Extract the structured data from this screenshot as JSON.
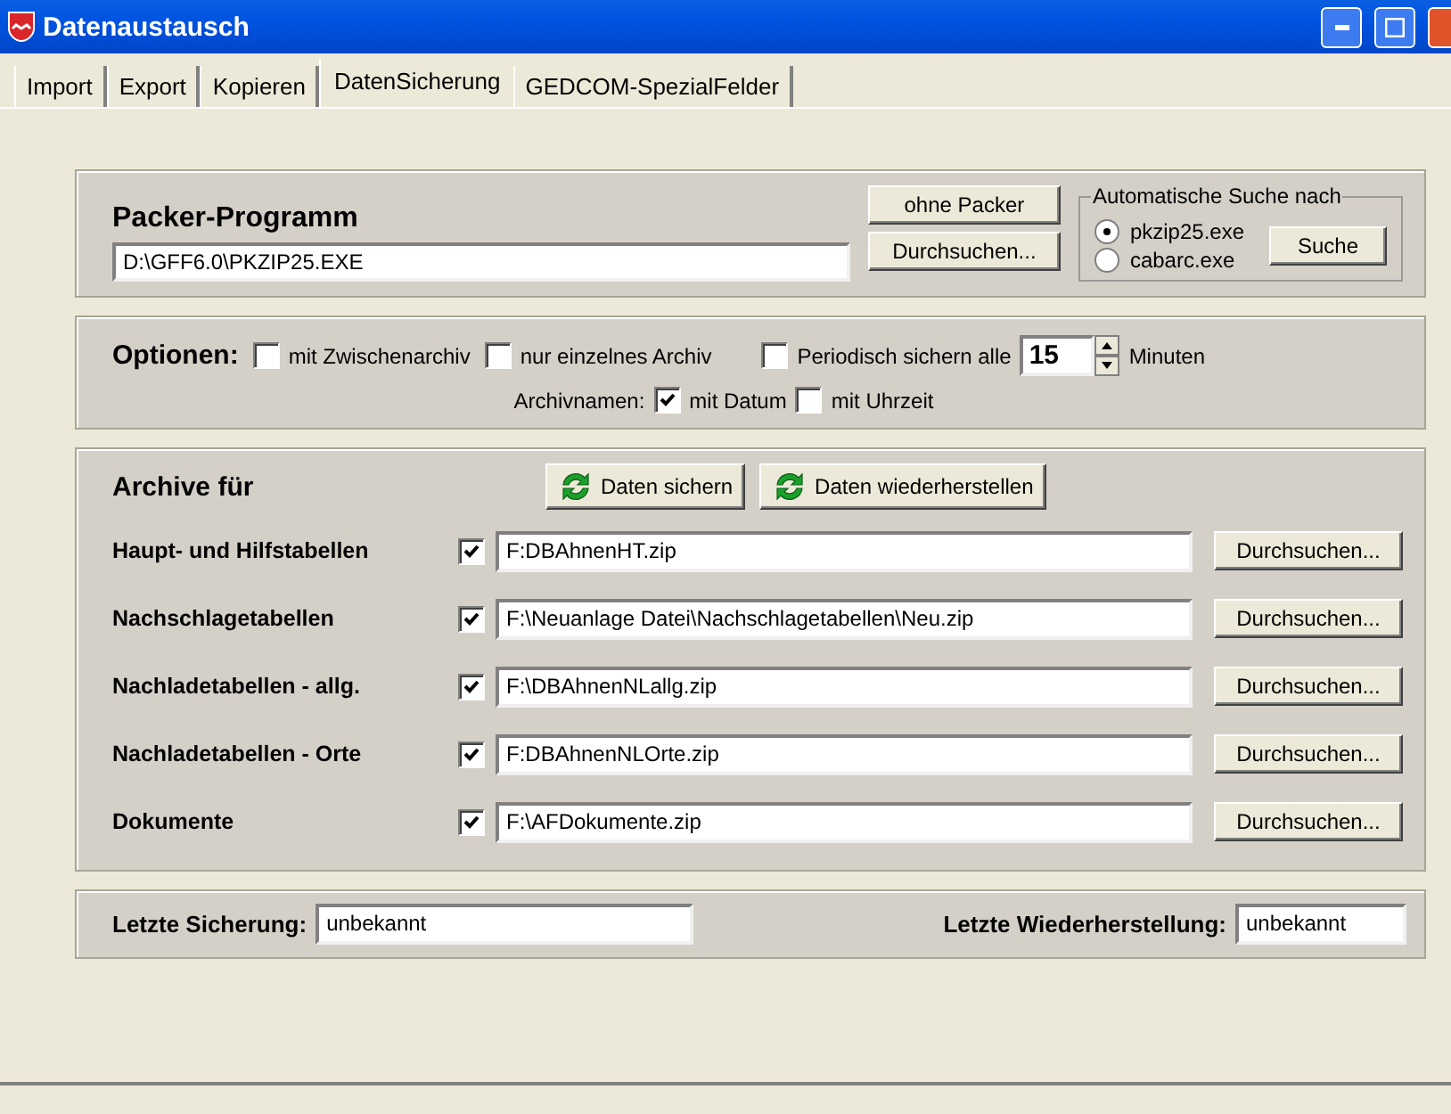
{
  "window": {
    "title": "Datenaustausch"
  },
  "tabs": [
    {
      "label": "Import",
      "selected": false
    },
    {
      "label": "Export",
      "selected": false
    },
    {
      "label": "Kopieren",
      "selected": false
    },
    {
      "label": "DatenSicherung",
      "selected": true
    },
    {
      "label": "GEDCOM-SpezialFelder",
      "selected": false
    }
  ],
  "packer": {
    "title": "Packer-Programm",
    "path": "D:\\GFF6.0\\PKZIP25.EXE",
    "buttons": [
      "ohne Packer",
      "Durchsuchen..."
    ],
    "auto_search": {
      "legend": "Automatische Suche nach",
      "options": [
        {
          "label": "pkzip25.exe",
          "selected": true
        },
        {
          "label": "cabarc.exe",
          "selected": false
        }
      ],
      "button": "Suche"
    }
  },
  "options": {
    "label": "Optionen:",
    "checks": [
      {
        "label": "mit Zwischenarchiv",
        "checked": false
      },
      {
        "label": "nur einzelnes Archiv",
        "checked": false
      }
    ],
    "periodic": {
      "label": "Periodisch sichern alle",
      "checked": false,
      "value": "15",
      "unit": "Minuten"
    },
    "archive_names": {
      "label": "Archivnamen:",
      "checks": [
        {
          "label": "mit Datum",
          "checked": true
        },
        {
          "label": "mit Uhrzeit",
          "checked": false
        }
      ]
    }
  },
  "archives": {
    "title": "Archive für",
    "actions": [
      "Daten sichern",
      "Daten wiederherstellen"
    ],
    "rows": [
      {
        "label": "Haupt- und Hilfstabellen",
        "checked": true,
        "path": "F:DBAhnenHT.zip",
        "button": "Durchsuchen..."
      },
      {
        "label": "Nachschlagetabellen",
        "checked": true,
        "path": "F:\\Neuanlage Datei\\Nachschlagetabellen\\Neu.zip",
        "button": "Durchsuchen..."
      },
      {
        "label": "Nachladetabellen - allg.",
        "checked": true,
        "path": "F:\\DBAhnenNLallg.zip",
        "button": "Durchsuchen..."
      },
      {
        "label": "Nachladetabellen - Orte",
        "checked": true,
        "path": "F:DBAhnenNLOrte.zip",
        "button": "Durchsuchen..."
      },
      {
        "label": "Dokumente",
        "checked": true,
        "path": "F:\\AFDokumente.zip",
        "button": "Durchsuchen..."
      }
    ]
  },
  "last": [
    {
      "label": "Letzte Sicherung:",
      "value": "unbekannt"
    },
    {
      "label": "Letzte Wiederherstellung:",
      "value": "unbekannt"
    }
  ]
}
